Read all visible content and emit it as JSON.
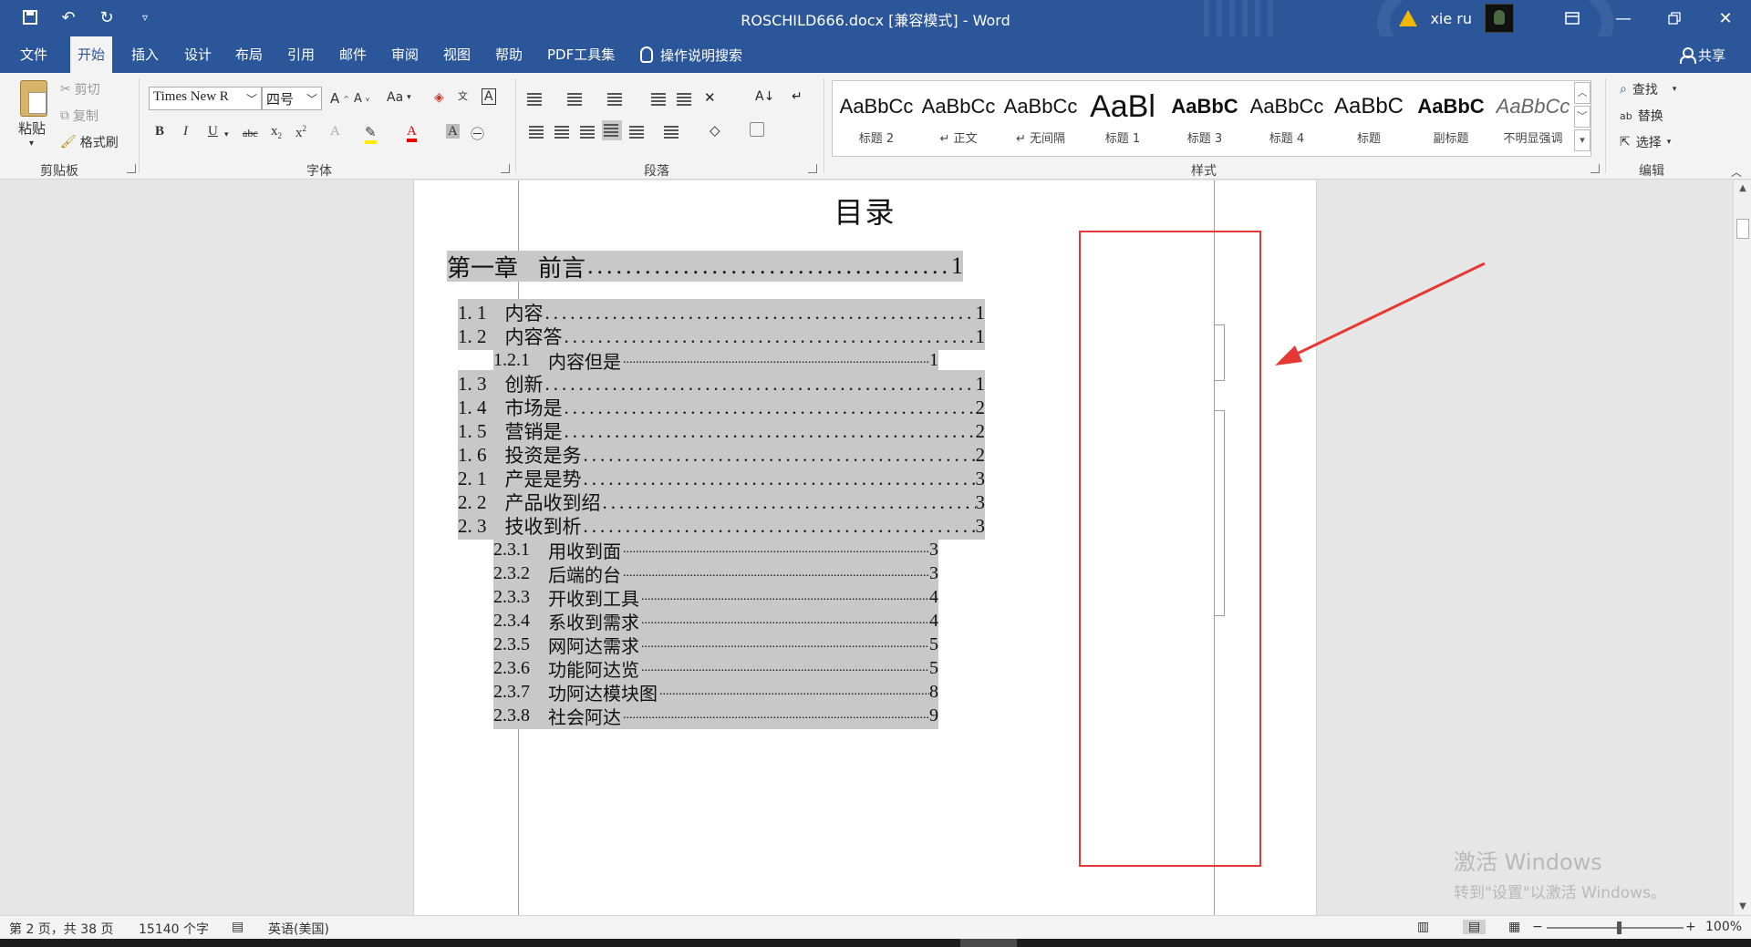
{
  "titlebar": {
    "title": "ROSCHILD666.docx [兼容模式]  -  Word",
    "user": "xie ru"
  },
  "tabs": [
    "文件",
    "开始",
    "插入",
    "设计",
    "布局",
    "引用",
    "邮件",
    "审阅",
    "视图",
    "帮助",
    "PDF工具集"
  ],
  "active_tab": "开始",
  "tell_me": "操作说明搜索",
  "share": "共享",
  "ribbon": {
    "clipboard": {
      "paste": "粘贴",
      "cut": "剪切",
      "copy": "复制",
      "format_painter": "格式刷",
      "label": "剪贴板"
    },
    "font": {
      "font_name": "Times New R",
      "font_size": "四号",
      "change_case": "Aa",
      "label": "字体"
    },
    "paragraph": {
      "label": "段落"
    },
    "styles": {
      "label": "样式",
      "items": [
        {
          "sample": "AaBbCc",
          "name": "标题 2"
        },
        {
          "sample": "AaBbCc",
          "name": "↵ 正文"
        },
        {
          "sample": "AaBbCc",
          "name": "↵ 无间隔"
        },
        {
          "sample": "AaBl",
          "name": "标题 1"
        },
        {
          "sample": "AaBbC",
          "name": "标题 3"
        },
        {
          "sample": "AaBbCc",
          "name": "标题 4"
        },
        {
          "sample": "AaBbC",
          "name": "标题"
        },
        {
          "sample": "AaBbC",
          "name": "副标题"
        },
        {
          "sample": "AaBbCc",
          "name": "不明显强调"
        }
      ]
    },
    "editing": {
      "find": "查找",
      "replace": "替换",
      "select": "选择",
      "label": "编辑"
    }
  },
  "document": {
    "title": "目录",
    "toc": [
      {
        "num": "第一章",
        "text": "前言",
        "page": "1",
        "level": 1
      },
      {
        "num": "1. 1",
        "text": "内容",
        "page": "1",
        "level": 2
      },
      {
        "num": "1. 2",
        "text": "内容答",
        "page": "1",
        "level": 2
      },
      {
        "num": "1.2.1",
        "text": "内容但是",
        "page": "1",
        "level": 3
      },
      {
        "num": "1. 3",
        "text": "创新",
        "page": "1",
        "level": 2
      },
      {
        "num": "1. 4",
        "text": "市场是",
        "page": "2",
        "level": 2
      },
      {
        "num": "1. 5",
        "text": "营销是",
        "page": "2",
        "level": 2
      },
      {
        "num": "1. 6",
        "text": "投资是务",
        "page": "2",
        "level": 2
      },
      {
        "num": "2. 1",
        "text": "产是是势",
        "page": "3",
        "level": 2
      },
      {
        "num": "2. 2",
        "text": "产品收到绍",
        "page": "3",
        "level": 2
      },
      {
        "num": "2. 3",
        "text": "技收到析",
        "page": "3",
        "level": 2
      },
      {
        "num": "2.3.1",
        "text": "用收到面",
        "page": "3",
        "level": 3
      },
      {
        "num": "2.3.2",
        "text": "后端的台",
        "page": "3",
        "level": 3
      },
      {
        "num": "2.3.3",
        "text": "开收到工具",
        "page": "4",
        "level": 3
      },
      {
        "num": "2.3.4",
        "text": "系收到需求",
        "page": "4",
        "level": 3
      },
      {
        "num": "2.3.5",
        "text": "网阿达需求",
        "page": "5",
        "level": 3
      },
      {
        "num": "2.3.6",
        "text": "功能阿达览",
        "page": "5",
        "level": 3
      },
      {
        "num": "2.3.7",
        "text": "功阿达模块图",
        "page": "8",
        "level": 3
      },
      {
        "num": "2.3.8",
        "text": "社会阿达",
        "page": "9",
        "level": 3
      }
    ]
  },
  "watermark": {
    "line1": "激活 Windows",
    "line2": "转到\"设置\"以激活 Windows。"
  },
  "statusbar": {
    "page": "第 2 页，共 38 页",
    "words": "15140 个字",
    "language": "英语(美国)",
    "zoom": "100%"
  },
  "colors": {
    "accent": "#2b579a",
    "annotation": "#e53935",
    "toc_highlight": "#c8c8c8"
  }
}
